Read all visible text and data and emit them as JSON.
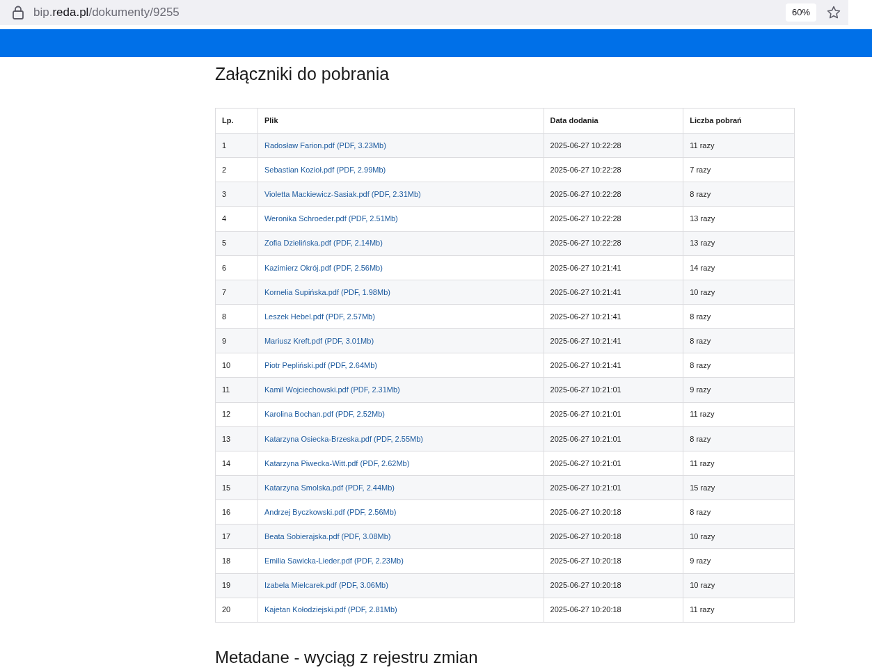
{
  "browser": {
    "url_parts": [
      {
        "text": "bip.",
        "emphasis": false
      },
      {
        "text": "reda.pl",
        "emphasis": true
      },
      {
        "text": "/dokumenty/9255",
        "emphasis": false
      }
    ],
    "zoom": "60%"
  },
  "attachments": {
    "title": "Załączniki do pobrania",
    "columns": [
      "Lp.",
      "Plik",
      "Data dodania",
      "Liczba pobrań"
    ],
    "rows": [
      [
        "1",
        "Radosław Farion.pdf (PDF, 3.23Mb)",
        "2025-06-27 10:22:28",
        "11 razy"
      ],
      [
        "2",
        "Sebastian Kozioł.pdf (PDF, 2.99Mb)",
        "2025-06-27 10:22:28",
        "7 razy"
      ],
      [
        "3",
        "Violetta Mackiewicz-Sasiak.pdf (PDF, 2.31Mb)",
        "2025-06-27 10:22:28",
        "8 razy"
      ],
      [
        "4",
        "Weronika Schroeder.pdf (PDF, 2.51Mb)",
        "2025-06-27 10:22:28",
        "13 razy"
      ],
      [
        "5",
        "Zofia Dzielińska.pdf (PDF, 2.14Mb)",
        "2025-06-27 10:22:28",
        "13 razy"
      ],
      [
        "6",
        "Kazimierz Okrój.pdf (PDF, 2.56Mb)",
        "2025-06-27 10:21:41",
        "14 razy"
      ],
      [
        "7",
        "Kornelia Supińska.pdf (PDF, 1.98Mb)",
        "2025-06-27 10:21:41",
        "10 razy"
      ],
      [
        "8",
        "Leszek Hebel.pdf (PDF, 2.57Mb)",
        "2025-06-27 10:21:41",
        "8 razy"
      ],
      [
        "9",
        "Mariusz Kreft.pdf (PDF, 3.01Mb)",
        "2025-06-27 10:21:41",
        "8 razy"
      ],
      [
        "10",
        "Piotr Pepliński.pdf (PDF, 2.64Mb)",
        "2025-06-27 10:21:41",
        "8 razy"
      ],
      [
        "11",
        "Kamil Wojciechowski.pdf (PDF, 2.31Mb)",
        "2025-06-27 10:21:01",
        "9 razy"
      ],
      [
        "12",
        "Karolina Bochan.pdf (PDF, 2.52Mb)",
        "2025-06-27 10:21:01",
        "11 razy"
      ],
      [
        "13",
        "Katarzyna Osiecka-Brzeska.pdf (PDF, 2.55Mb)",
        "2025-06-27 10:21:01",
        "8 razy"
      ],
      [
        "14",
        "Katarzyna Piwecka-Witt.pdf (PDF, 2.62Mb)",
        "2025-06-27 10:21:01",
        "11 razy"
      ],
      [
        "15",
        "Katarzyna Smolska.pdf (PDF, 2.44Mb)",
        "2025-06-27 10:21:01",
        "15 razy"
      ],
      [
        "16",
        "Andrzej Byczkowski.pdf (PDF, 2.56Mb)",
        "2025-06-27 10:20:18",
        "8 razy"
      ],
      [
        "17",
        "Beata Sobierajska.pdf (PDF, 3.08Mb)",
        "2025-06-27 10:20:18",
        "10 razy"
      ],
      [
        "18",
        "Emilia Sawicka-Lieder.pdf (PDF, 2.23Mb)",
        "2025-06-27 10:20:18",
        "9 razy"
      ],
      [
        "19",
        "Izabela Mielcarek.pdf (PDF, 3.06Mb)",
        "2025-06-27 10:20:18",
        "10 razy"
      ],
      [
        "20",
        "Kajetan Kołodziejski.pdf (PDF, 2.81Mb)",
        "2025-06-27 10:20:18",
        "11 razy"
      ]
    ]
  },
  "metadata": {
    "title": "Metadane - wyciąg z rejestru zmian"
  }
}
